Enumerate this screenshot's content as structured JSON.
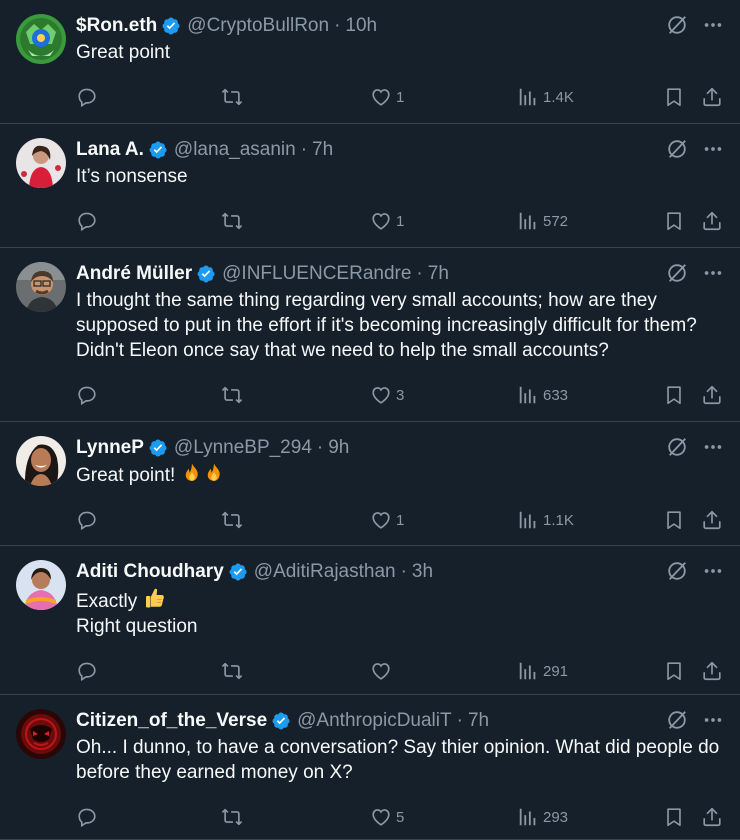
{
  "tweets": [
    {
      "name": "$Ron.eth",
      "handle": "@CryptoBullRon",
      "sep": "·",
      "time": "10h",
      "lines": [
        "Great point"
      ],
      "likes": "1",
      "views": "1.4K",
      "avatar": "crypto-bull-avatar"
    },
    {
      "name": "Lana A.",
      "handle": "@lana_asanin",
      "sep": "·",
      "time": "7h",
      "lines": [
        "It’s nonsense"
      ],
      "likes": "1",
      "views": "572",
      "avatar": "woman-red-dress-avatar"
    },
    {
      "name": "André Müller",
      "handle": "@INFLUENCERandre",
      "sep": "·",
      "time": "7h",
      "lines": [
        "I thought the same thing regarding very small accounts; how are they",
        "supposed to put in the effort if it's becoming increasingly difficult for them?",
        "Didn't Eleon once say that we need to help the small accounts?"
      ],
      "likes": "3",
      "views": "633",
      "avatar": "man-glasses-avatar"
    },
    {
      "name": "LynneP",
      "handle": "@LynneBP_294",
      "sep": "·",
      "time": "9h",
      "lines": [
        "Great point!"
      ],
      "emoji": "fire-fire",
      "likes": "1",
      "views": "1.1K",
      "avatar": "woman-smiling-avatar"
    },
    {
      "name": "Aditi Choudhary",
      "handle": "@AditiRajasthan",
      "sep": "·",
      "time": "3h",
      "lines": [
        "Exactly",
        "Right question"
      ],
      "emoji": "thumbs-up",
      "likes": "",
      "views": "291",
      "avatar": "woman-scarf-avatar"
    },
    {
      "name": "Citizen_of_the_Verse",
      "handle": "@AnthropicDualiT",
      "sep": "·",
      "time": "7h",
      "lines": [
        "Oh... I dunno, to have a conversation? Say thier opinion. What did people do",
        "before they earned money on X?"
      ],
      "likes": "5",
      "views": "293",
      "avatar": "red-mask-avatar"
    }
  ],
  "colors": {
    "background": "#15202b",
    "divider": "#38444d",
    "text": "#f7f9f9",
    "muted": "#8b98a5",
    "verified": "#1d9bf0"
  }
}
